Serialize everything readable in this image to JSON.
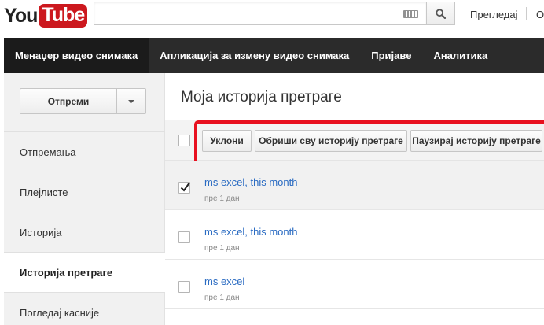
{
  "header": {
    "logo": {
      "you": "You",
      "tube": "Tube"
    },
    "search": {
      "value": "",
      "placeholder": ""
    },
    "icons": {
      "keyboard": "keyboard-icon",
      "search": "search-icon"
    },
    "browse_link": "Прегледај",
    "clipped_link": "О"
  },
  "nav": {
    "tabs": [
      {
        "label": "Менаџер видео снимака",
        "active": true
      },
      {
        "label": "Апликација за измену видео снимака",
        "active": false
      },
      {
        "label": "Пријаве",
        "active": false
      },
      {
        "label": "Аналитика",
        "active": false
      }
    ]
  },
  "sidebar": {
    "upload_label": "Отпреми",
    "items": [
      {
        "label": "Отпремања",
        "active": false
      },
      {
        "label": "Плејлисте",
        "active": false
      },
      {
        "label": "Историја",
        "active": false
      },
      {
        "label": "Историја претраге",
        "active": true
      },
      {
        "label": "Погледај касније",
        "active": false
      }
    ]
  },
  "main": {
    "title": "Моја историја претраге",
    "toolbar": {
      "select_all_checked": false,
      "remove_label": "Уклони",
      "clear_all_label": "Обриши сву историју претраге",
      "pause_label": "Паузирај историју претраге"
    },
    "entries": [
      {
        "query": "ms excel, this month",
        "time": "пре 1 дан",
        "checked": true
      },
      {
        "query": "ms excel, this month",
        "time": "пре 1 дан",
        "checked": false
      },
      {
        "query": "ms excel",
        "time": "пре 1 дан",
        "checked": false
      }
    ]
  },
  "colors": {
    "brand_red": "#cc181e",
    "highlight_red": "#e8101f",
    "link_blue": "#2a6bc2",
    "nav_dark": "#2b2b2b"
  }
}
